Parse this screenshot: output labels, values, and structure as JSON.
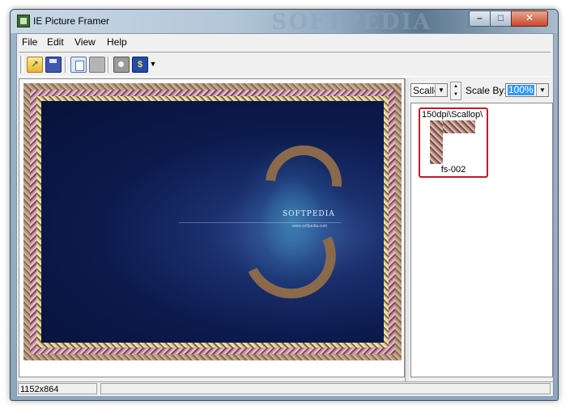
{
  "window": {
    "title": "IE Picture Framer",
    "watermark": "SOFTPEDIA"
  },
  "controls": {
    "minimize": "–",
    "maximize": "□",
    "close": "✕"
  },
  "menu": [
    "File",
    "Edit",
    "View",
    "Help"
  ],
  "toolbar": {
    "buttons": [
      "open-icon",
      "save-icon",
      "copy-icon",
      "paste-icon",
      "camera-icon",
      "frame-icon",
      "dropdown-icon"
    ],
    "frame_glyph": "$",
    "open_glyph": "↗",
    "dropdown_glyph": "▼"
  },
  "canvas": {
    "photo_brand": "SOFTPEDIA",
    "photo_sub": "www.softpedia.com"
  },
  "side": {
    "frame_style": "Scallc",
    "scale_label": "Scale By:",
    "scale_value": "100%",
    "arrow": "▼",
    "spin_up": "▲",
    "spin_down": "▼"
  },
  "thumbs": [
    {
      "path": "150dpi\\Scallop\\",
      "name": "fs-002"
    }
  ],
  "status": {
    "dimensions": "1152x864"
  },
  "colors": {
    "selection": "#3399ff",
    "thumb_border": "#c01a2a"
  }
}
